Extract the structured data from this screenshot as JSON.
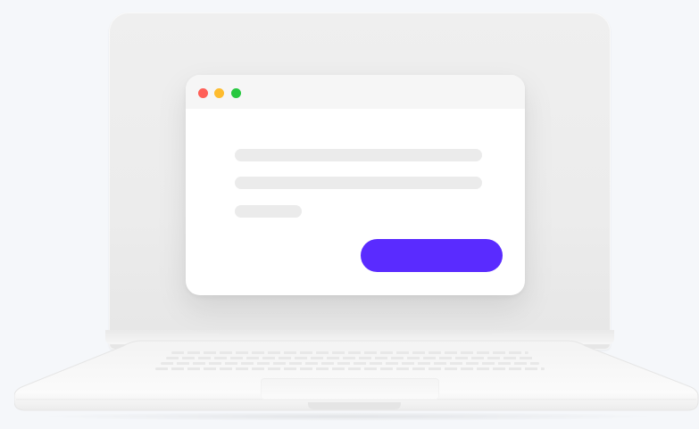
{
  "window": {
    "traffic_lights": [
      {
        "role": "close",
        "color": "#ff5f57"
      },
      {
        "role": "minimize",
        "color": "#febc2e"
      },
      {
        "role": "maximize",
        "color": "#28c840"
      }
    ],
    "primary_button": {
      "label": "",
      "color": "#5a2bff"
    }
  },
  "colors": {
    "background": "#f5f7fa",
    "placeholder_line": "#ebebeb"
  }
}
